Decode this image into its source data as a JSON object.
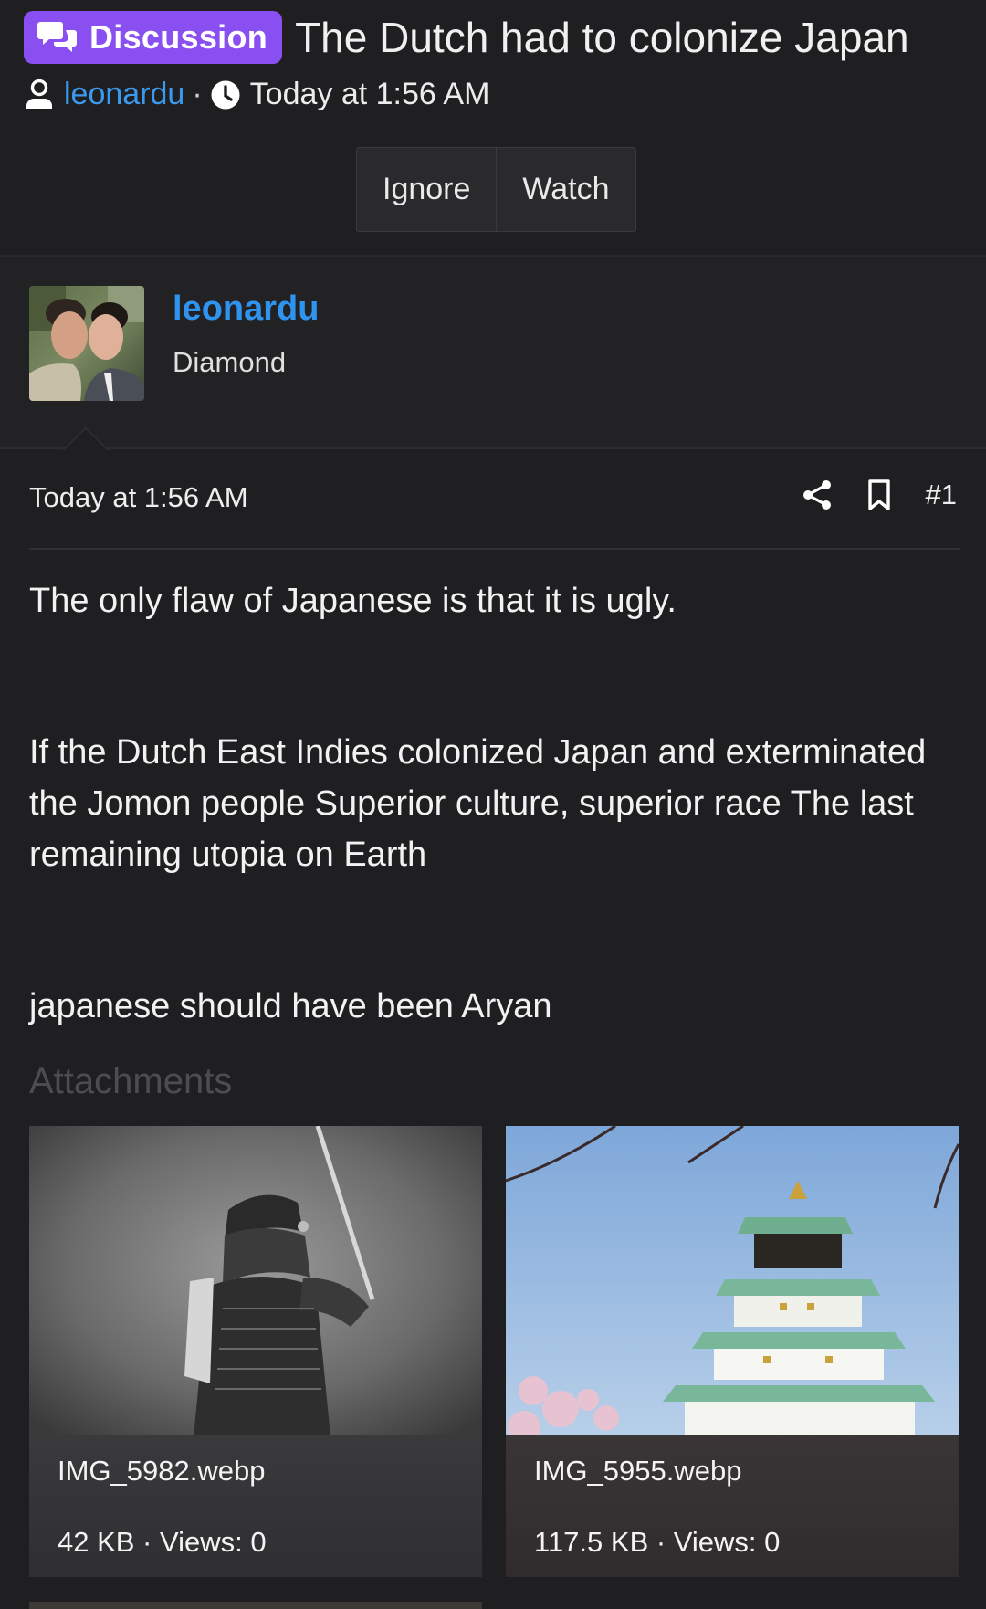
{
  "thread": {
    "prefix": "Discussion",
    "title": "The Dutch had to colonize Japan",
    "author": "leonardu",
    "separator": "·",
    "date": "Today at 1:56 AM",
    "ignore_label": "Ignore",
    "watch_label": "Watch"
  },
  "user": {
    "name": "leonardu",
    "title": "Diamond"
  },
  "post": {
    "date": "Today at 1:56 AM",
    "number": "#1",
    "paragraphs": [
      "The only flaw of Japanese is that it is ugly.",
      "If the Dutch East Indies colonized Japan and exterminated the Jomon people Superior culture, superior race The last remaining utopia on Earth",
      "japanese should have been Aryan"
    ]
  },
  "attachments": {
    "label": "Attachments",
    "items": [
      {
        "filename": "IMG_5982.webp",
        "info": "42 KB · Views: 0"
      },
      {
        "filename": "IMG_5955.webp",
        "info": "117.5 KB · Views: 0"
      }
    ]
  },
  "colors": {
    "prefix_bg": "#8a4ff0",
    "link": "#2f94ef",
    "page_bg": "#1f1f21"
  },
  "icons": [
    "discussion-icon",
    "user-icon",
    "clock-icon",
    "share-icon",
    "bookmark-icon"
  ]
}
